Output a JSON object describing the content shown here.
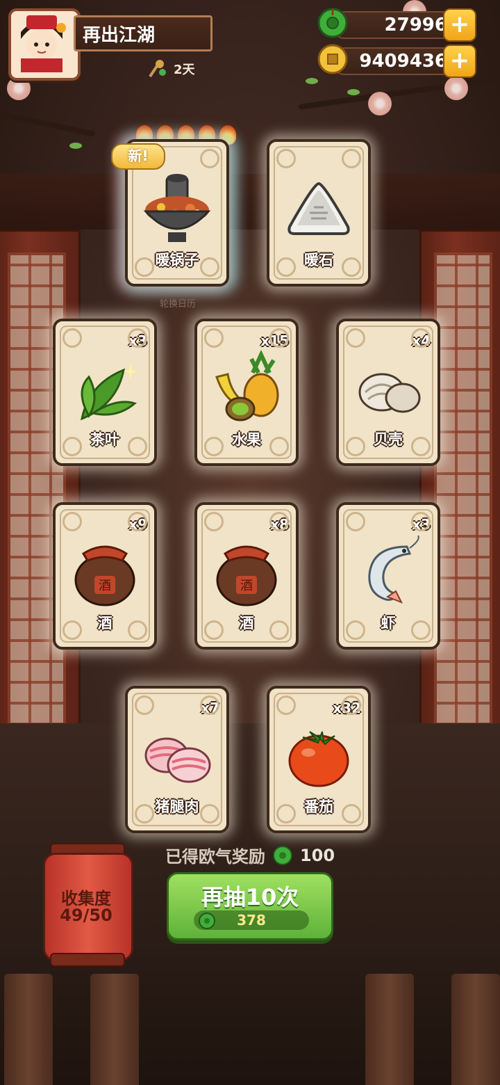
{
  "player": {
    "name": "再出江湖",
    "days": "2天"
  },
  "currency": {
    "jade": "27996",
    "coins": "9409436"
  },
  "featured": [
    {
      "label": "暖锅子",
      "is_new": true,
      "new_label": "新",
      "rating": 5
    },
    {
      "label": "暖石"
    }
  ],
  "rotate_label": "轮换日历",
  "grid": [
    {
      "label": "茶叶",
      "count": "x3"
    },
    {
      "label": "水果",
      "count": "x15"
    },
    {
      "label": "贝壳",
      "count": "x4"
    },
    {
      "label": "酒",
      "count": "x9"
    },
    {
      "label": "酒",
      "count": "x8"
    },
    {
      "label": "虾",
      "count": "x3"
    },
    {
      "label": "猪腿肉",
      "count": "x7"
    },
    {
      "label": "番茄",
      "count": "x32"
    }
  ],
  "reward": {
    "text": "已得欧气奖励",
    "value": "100"
  },
  "collection": {
    "title": "收集度",
    "progress": "49/50"
  },
  "draw_button": {
    "label": "再抽10次",
    "cost": "378"
  },
  "colors": {
    "button_green": "#5fb23a",
    "gold": "#f0a418",
    "lantern_red": "#e15a44"
  }
}
